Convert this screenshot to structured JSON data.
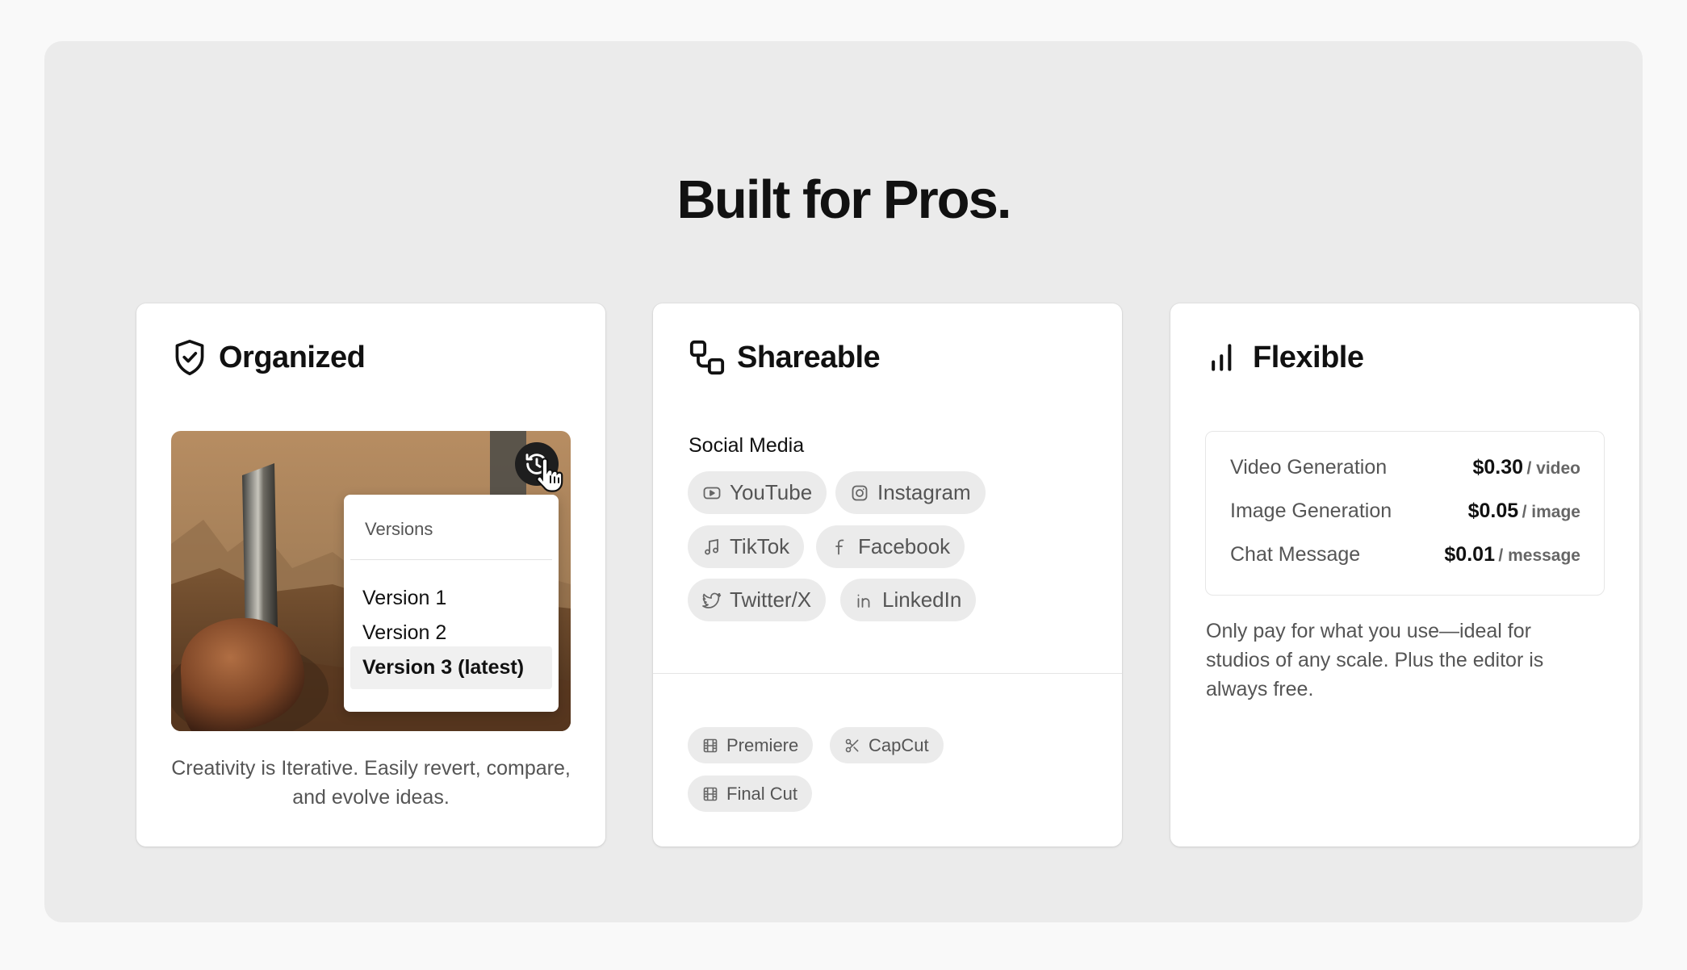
{
  "headline": "Built for Pros.",
  "cards": {
    "organized": {
      "title": "Organized",
      "icon": "shield-check-icon",
      "menu": {
        "label": "Versions",
        "items": [
          "Version 1",
          "Version 2",
          "Version 3 (latest)"
        ],
        "selected": "Version 3 (latest)"
      },
      "description": "Creativity is Iterative. Easily revert, compare, and evolve ideas."
    },
    "shareable": {
      "title": "Shareable",
      "icon": "share-nodes-icon",
      "social_label": "Social Media",
      "social": [
        {
          "label": "YouTube",
          "icon": "youtube-icon"
        },
        {
          "label": "Instagram",
          "icon": "instagram-icon"
        },
        {
          "label": "TikTok",
          "icon": "tiktok-icon"
        },
        {
          "label": "Facebook",
          "icon": "facebook-icon"
        },
        {
          "label": "Twitter/X",
          "icon": "twitter-icon"
        },
        {
          "label": "LinkedIn",
          "icon": "linkedin-icon"
        }
      ],
      "editors": [
        {
          "label": "Premiere",
          "icon": "film-icon"
        },
        {
          "label": "CapCut",
          "icon": "scissors-icon"
        },
        {
          "label": "Final Cut",
          "icon": "film-icon"
        }
      ]
    },
    "flexible": {
      "title": "Flexible",
      "icon": "bar-chart-icon",
      "prices": [
        {
          "name": "Video Generation",
          "price": "$0.30",
          "unit": "/ video"
        },
        {
          "name": "Image Generation",
          "price": "$0.05",
          "unit": "/ image"
        },
        {
          "name": "Chat Message",
          "price": "$0.01",
          "unit": "/ message"
        }
      ],
      "description": "Only pay for what you use—ideal for studios of any scale. Plus the editor is always free."
    }
  },
  "colors": {
    "page_bg": "#f9f9f9",
    "panel_bg": "#ebebeb",
    "card_bg": "#ffffff",
    "chip_bg": "#ebebeb",
    "text_primary": "#111111",
    "text_muted": "#555555"
  }
}
